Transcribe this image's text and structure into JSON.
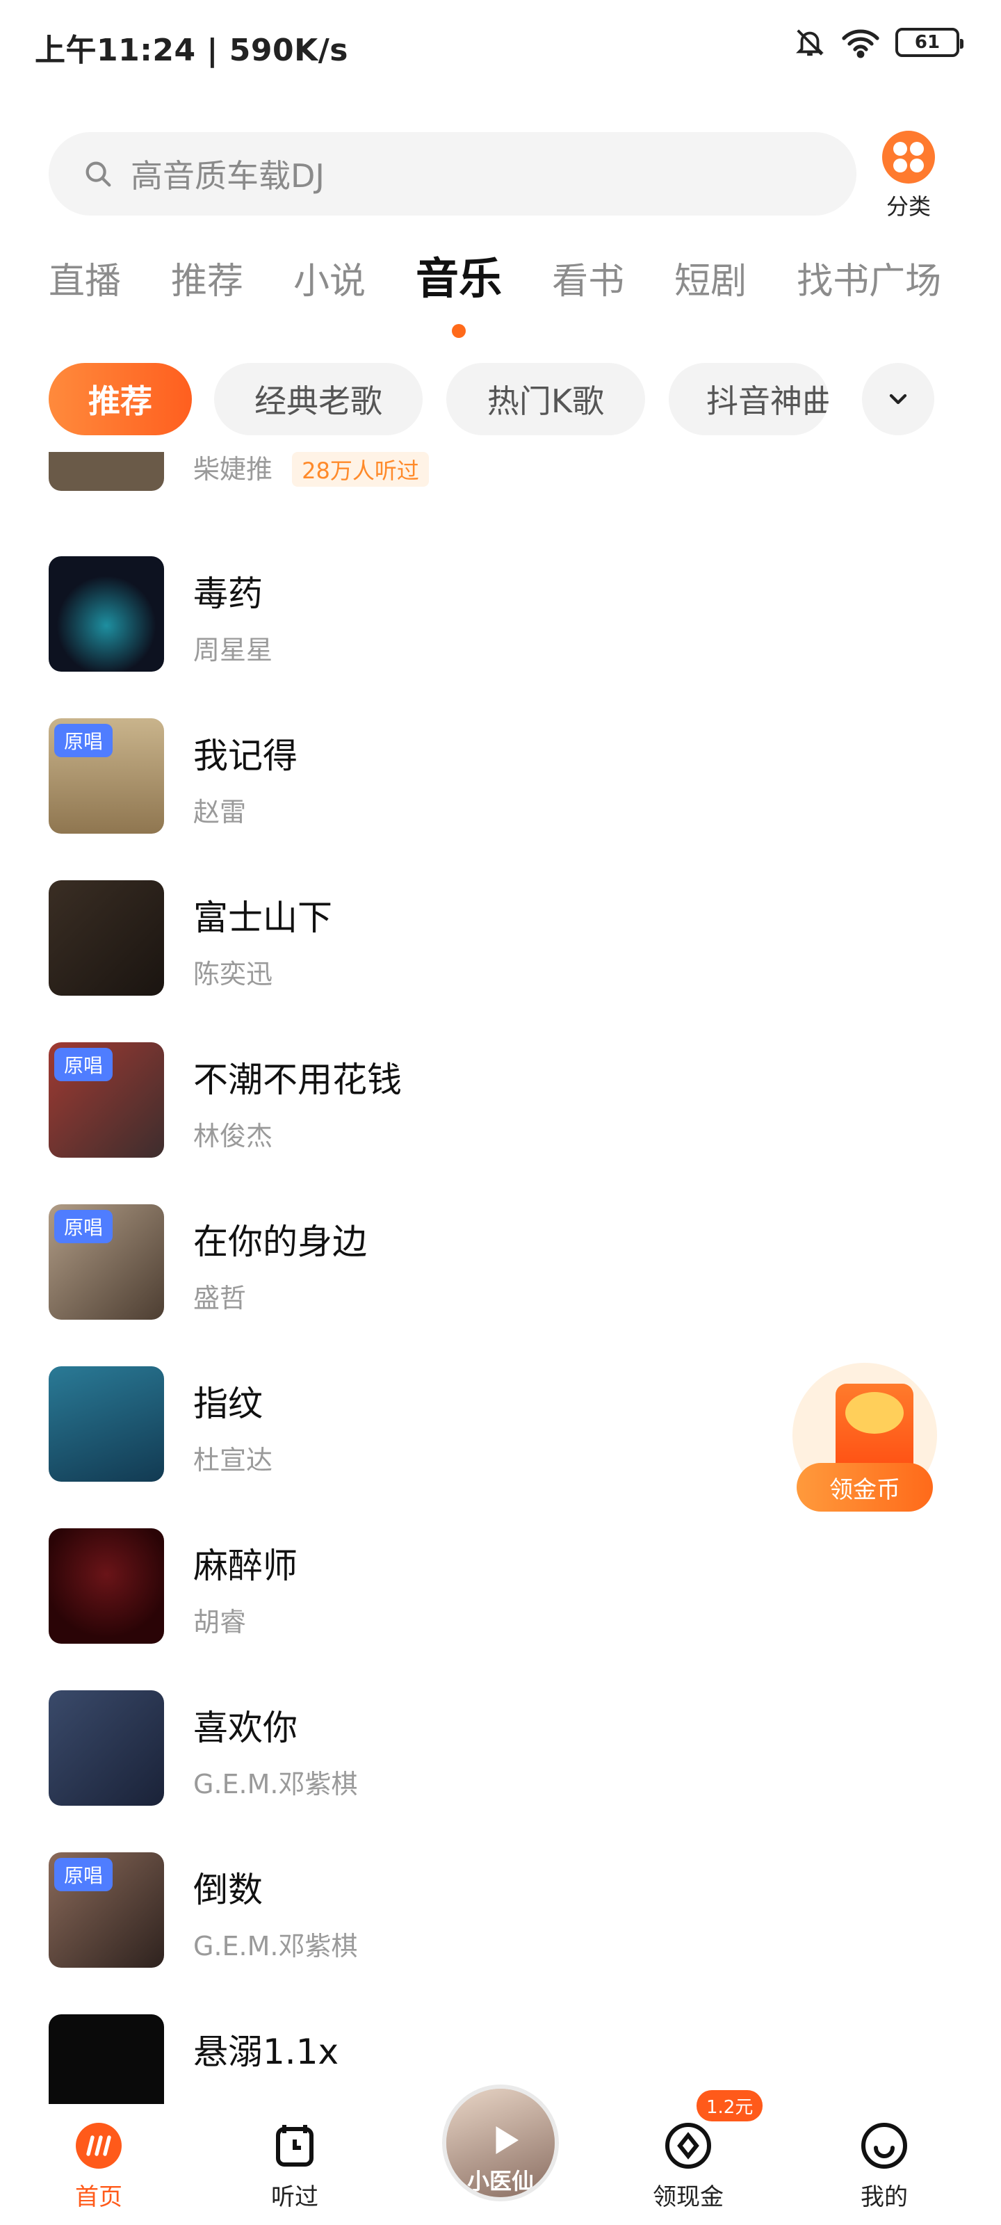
{
  "status_bar": {
    "time_speed": "上午11:24 | 590K/s",
    "battery": "61"
  },
  "search": {
    "placeholder": "高音质车载DJ"
  },
  "category": {
    "label": "分类"
  },
  "tabs": [
    {
      "label": "直播",
      "active": false
    },
    {
      "label": "推荐",
      "active": false
    },
    {
      "label": "小说",
      "active": false
    },
    {
      "label": "音乐",
      "active": true
    },
    {
      "label": "看书",
      "active": false
    },
    {
      "label": "短剧",
      "active": false
    },
    {
      "label": "找书广场",
      "active": false
    }
  ],
  "chips": [
    {
      "label": "推荐",
      "active": true
    },
    {
      "label": "经典老歌",
      "active": false
    },
    {
      "label": "热门K歌",
      "active": false
    },
    {
      "label": "抖音神曲",
      "active": false
    }
  ],
  "partial_top": {
    "artist": "柴婕推",
    "listen_tag": "28万人听过"
  },
  "songs": [
    {
      "title": "毒药",
      "artist": "周星星",
      "badge": ""
    },
    {
      "title": "我记得",
      "artist": "赵雷",
      "badge": "原唱"
    },
    {
      "title": "富士山下",
      "artist": "陈奕迅",
      "badge": ""
    },
    {
      "title": "不潮不用花钱",
      "artist": "林俊杰",
      "badge": "原唱"
    },
    {
      "title": "在你的身边",
      "artist": "盛哲",
      "badge": "原唱"
    },
    {
      "title": "指纹",
      "artist": "杜宣达",
      "badge": ""
    },
    {
      "title": "麻醉师",
      "artist": "胡睿",
      "badge": ""
    },
    {
      "title": "喜欢你",
      "artist": "G.E.M.邓紫棋",
      "badge": ""
    },
    {
      "title": "倒数",
      "artist": "G.E.M.邓紫棋",
      "badge": "原唱"
    },
    {
      "title": "悬溺1.1x",
      "artist": "",
      "badge": ""
    }
  ],
  "cover_colors": [
    "#0d1220",
    "#b59a6e",
    "#2d241e",
    "#6a3a36",
    "#8d7a67",
    "#1e5d78",
    "#3a0a0c",
    "#2c3a55",
    "#4e3a34",
    "#0a0a0a"
  ],
  "floating": {
    "coin_label": "领金币"
  },
  "bottom_nav": {
    "home": "首页",
    "history": "听过",
    "player_text": "小医仙",
    "cash": "领现金",
    "cash_badge": "1.2元",
    "mine": "我的"
  },
  "colors": {
    "accent": "#ff6a1a",
    "badge_blue": "#4f7dff"
  }
}
